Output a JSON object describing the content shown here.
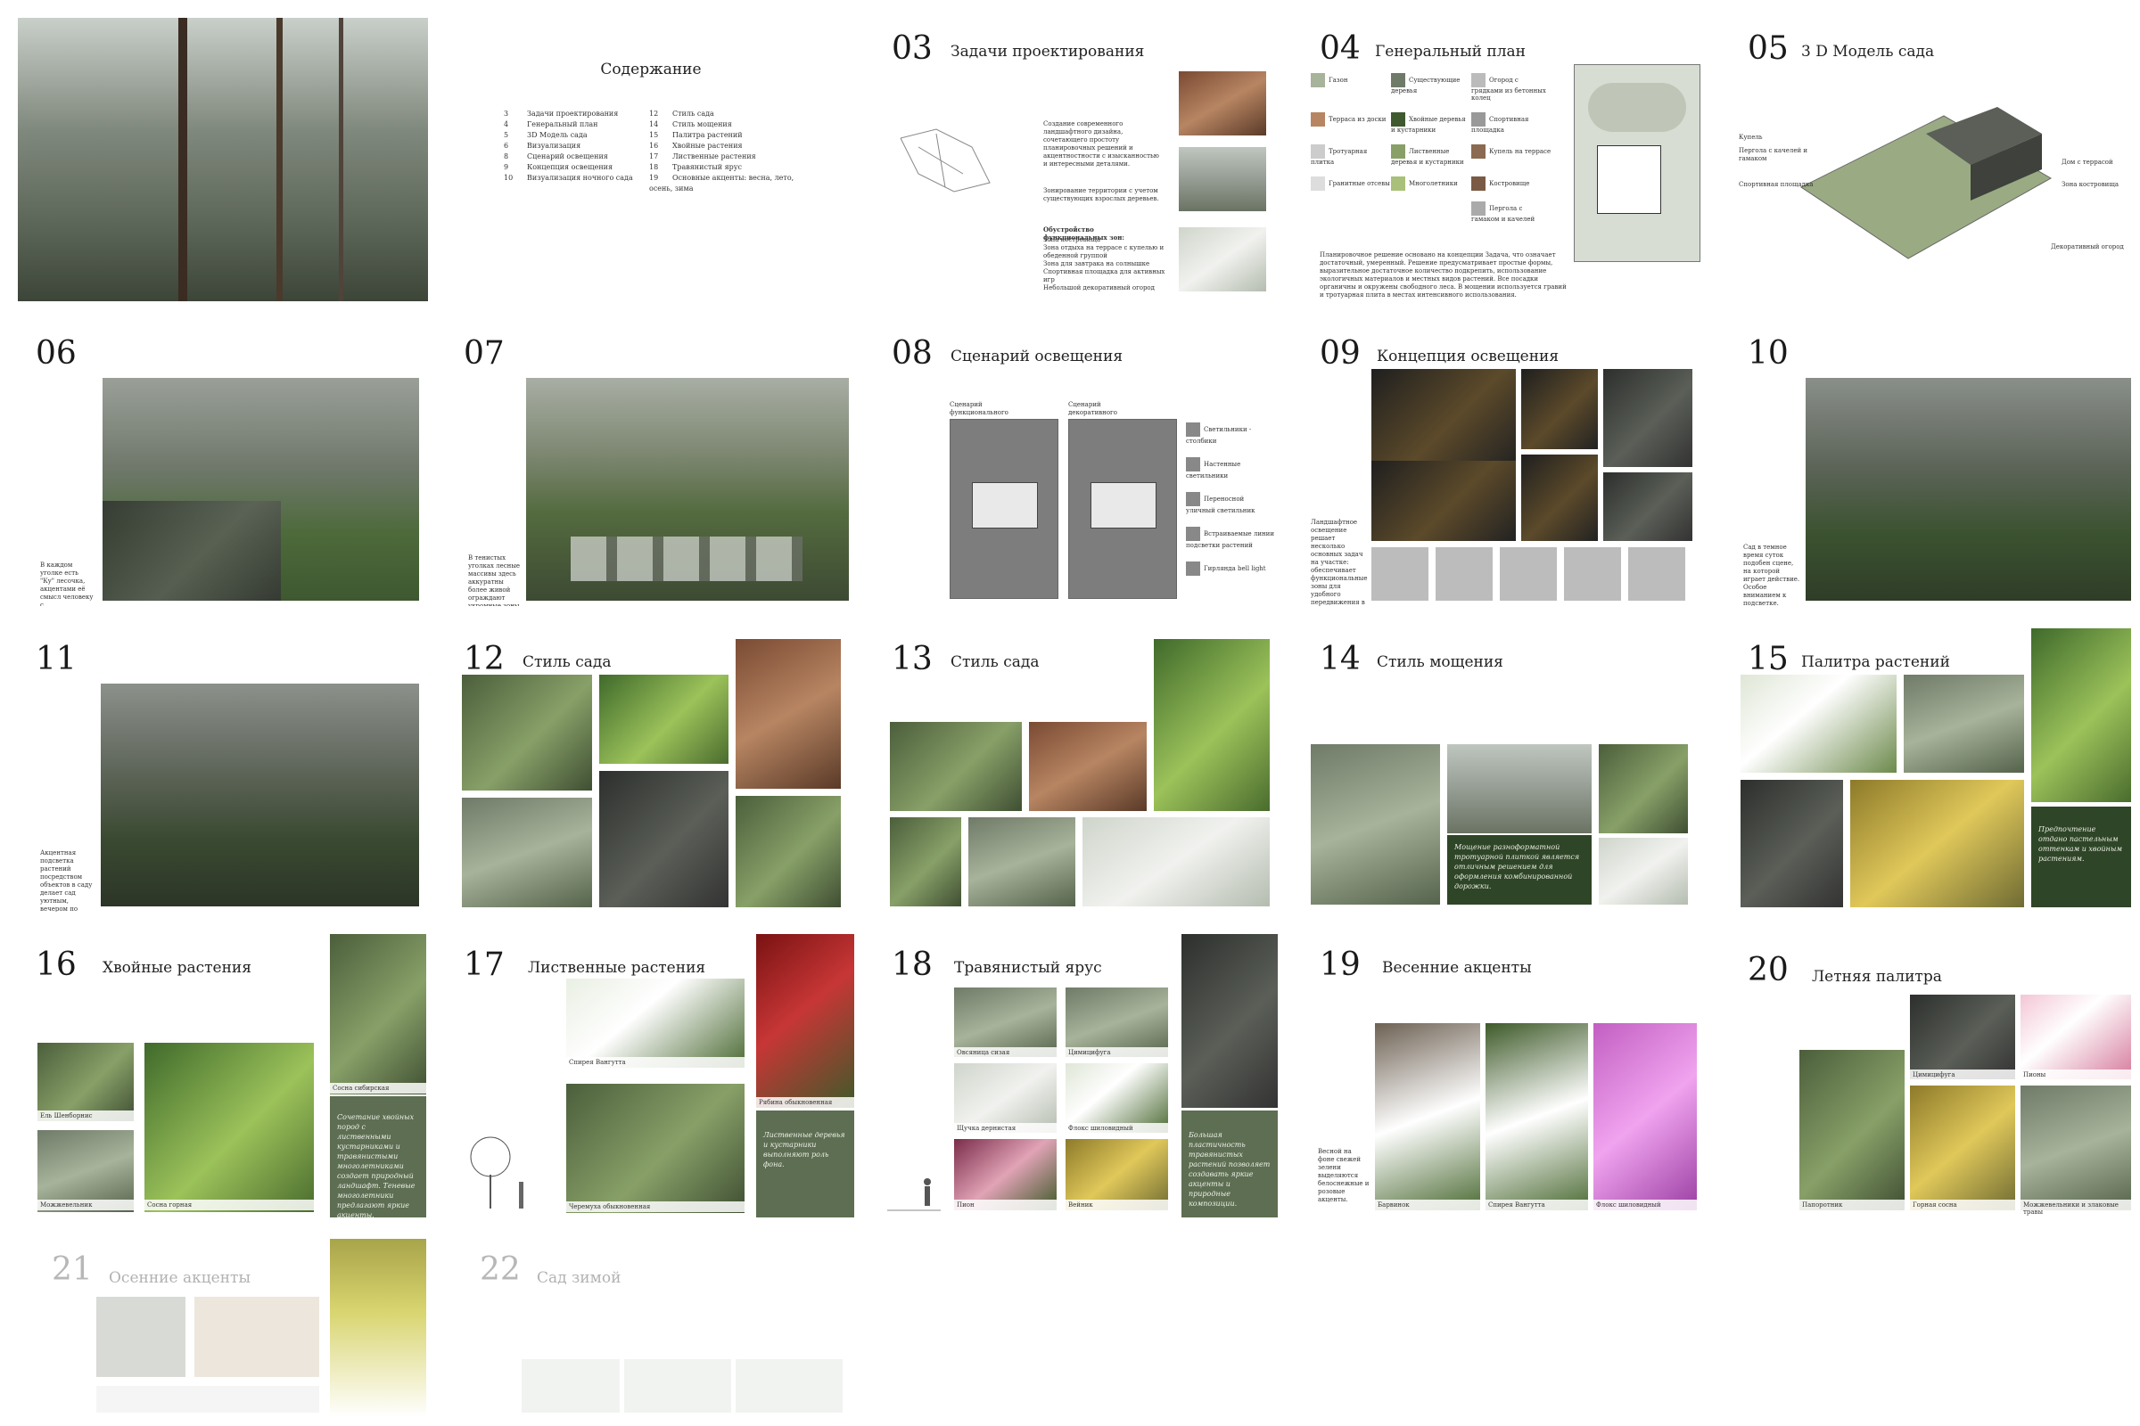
{
  "toc": {
    "title": "Содержание",
    "left": [
      {
        "n": "3",
        "t": "Задачи проектирования"
      },
      {
        "n": "4",
        "t": "Генеральный план"
      },
      {
        "n": "5",
        "t": "3D Модель сада"
      },
      {
        "n": "6",
        "t": "Визуализация"
      },
      {
        "n": "8",
        "t": "Сценарий освещения"
      },
      {
        "n": "9",
        "t": "Концепция освещения"
      },
      {
        "n": "10",
        "t": "Визуализация ночного сада"
      }
    ],
    "right": [
      {
        "n": "12",
        "t": "Стиль сада"
      },
      {
        "n": "14",
        "t": "Стиль мощения"
      },
      {
        "n": "15",
        "t": "Палитра растений"
      },
      {
        "n": "16",
        "t": "Хвойные растения"
      },
      {
        "n": "17",
        "t": "Лиственные растения"
      },
      {
        "n": "18",
        "t": "Травянистый ярус"
      },
      {
        "n": "19",
        "t": "Основные акценты: весна, лето, осень, зима"
      }
    ]
  },
  "slides": {
    "s03": {
      "num": "03",
      "title": "Задачи проектирования",
      "text1": "Создание современного ландшафтного дизайна, сочетающего простоту планировочных решений и акцентностности с изысканностью и интересными деталями.",
      "text2": "Зонирование территории с учетом существующих взрослых деревьев.",
      "text3": "Обустройство функциональных зон:",
      "zones": [
        "Зона костровища",
        "Зона отдыха на террасе с купелью и обеденной группой",
        "Зона для завтрака на солнышке",
        "Спортивная площадка для активных игр",
        "Небольшой декоративный огород"
      ]
    },
    "s04": {
      "num": "04",
      "title": "Генеральный план",
      "legend": [
        "Газон",
        "Существующие деревья",
        "Огород с грядками из бетонных колец",
        "Терраса из доски",
        "Хвойные деревья и кустарники",
        "Спортивная площадка",
        "Тротуарная плитка",
        "Лиственные деревья и кустарники",
        "Купель на террасе",
        "Гранитные отсевы",
        "Многолетники",
        "Костровище",
        "Пергола с гамаком и качелей"
      ],
      "text": "Планировочное решение основано на концепции Задача, что означает достаточный, умеренный. Решение предусматривает простые формы, выразительное достаточное количество подкрепить, использование экологичных материалов и местных видов растений. Все посадки органичны и окружены свободного леса. В мощении используется гравий и тротуарная плита в местах интенсивного использования."
    },
    "s05": {
      "num": "05",
      "title": "3 D  Модель сада",
      "labels": [
        "Купель",
        "Пергола с качелей и гамаком",
        "Спортивная площадка",
        "Дом с террасой",
        "Зона костровища",
        "Декоративный огород"
      ]
    },
    "s06": {
      "num": "06",
      "text": "В каждом уголке есть \"Ку\" лесочка, акцентами её смысл человеку с пространством."
    },
    "s07": {
      "num": "07",
      "text": "В тенистых уголках лесные массивы здесь аккуратны более живой ограждают укромные зоны отдыха."
    },
    "s08": {
      "num": "08",
      "title": "Сценарий освещения",
      "plan1": "Сценарий функционального освещения сада",
      "plan2": "Сценарий декоративного освещения сада",
      "legend": [
        "Светильники - столбики",
        "Настенные светильники",
        "Переносной уличный светильник",
        "Встраиваемые линии подсветки растений",
        "Гирлянда bell light"
      ]
    },
    "s09": {
      "num": "09",
      "title": "Концепция освещения",
      "text": "Ландшафтное освещение решает несколько основных задач на участке: обеспечивает функциональные зоны для удобного передвижения в вечернее и ночное время; создает атмосферу, подчеркивая уникальные участки."
    },
    "s10": {
      "num": "10",
      "text": "Сад в темное время суток подобен сцене, на которой играет действие. Особое вниманием к подсветке."
    },
    "s11": {
      "num": "11",
      "text": "Акцентная подсветка растений посредством объектов в саду делает сад уютным, вечером по дорожкам и создает особый уголок."
    },
    "s12": {
      "num": "12",
      "title": "Стиль сада"
    },
    "s13": {
      "num": "13",
      "title": "Стиль сада"
    },
    "s14": {
      "num": "14",
      "title": "Стиль мощения",
      "text": "Мощение разноформатной тротуарной плиткой является отличным решением для оформления комбинированной дорожки."
    },
    "s15": {
      "num": "15",
      "title": "Палитра растений",
      "text": "Предпочтение отдано пастельным оттенкам и хвойным растениям."
    },
    "s16": {
      "num": "16",
      "title": "Хвойные растения",
      "caps": [
        "Ель Шенборнис",
        "Сосна сибирская",
        "Можжевельник",
        "Сосна горная"
      ],
      "text": "Сочетание хвойных пород с лиственными кустарниками и травянистыми многолетниками создает природный ландшафт. Теневые многолетники предлагают яркие акценты."
    },
    "s17": {
      "num": "17",
      "title": "Лиственные растения",
      "caps": [
        "Спирея Вангутта",
        "Рябина обыкновенная",
        "Черемуха обыкновенная"
      ],
      "text": "Лиственные деревья и кустарники выполняют роль фона."
    },
    "s18": {
      "num": "18",
      "title": "Травянистый ярус",
      "caps": [
        "Овсяница сизая",
        "Щучка дернистая",
        "Пион",
        "Цимицифуга",
        "Флокс шиловидный",
        "Вейник"
      ],
      "text": "Большая пластичность травянистых растений позволяет создавать яркие акценты и природные композиции."
    },
    "s19": {
      "num": "19",
      "title": "Весенние акценты",
      "caps": [
        "Барвинок",
        "Спирея Вангутта",
        "Флокс шиловидный"
      ],
      "text": "Весной на фоне свежей зелени выделяются белоснежные и розовые акценты."
    },
    "s20": {
      "num": "20",
      "title": "Летняя палитра",
      "caps": [
        "Цимицифуга",
        "Пионы",
        "Папоротник",
        "Горная сосна",
        "Можжевельники и злаковые травы"
      ]
    },
    "s21": {
      "num": "21",
      "title": "Осенние акценты"
    },
    "s22": {
      "num": "22",
      "title": "Сад зимой"
    }
  }
}
